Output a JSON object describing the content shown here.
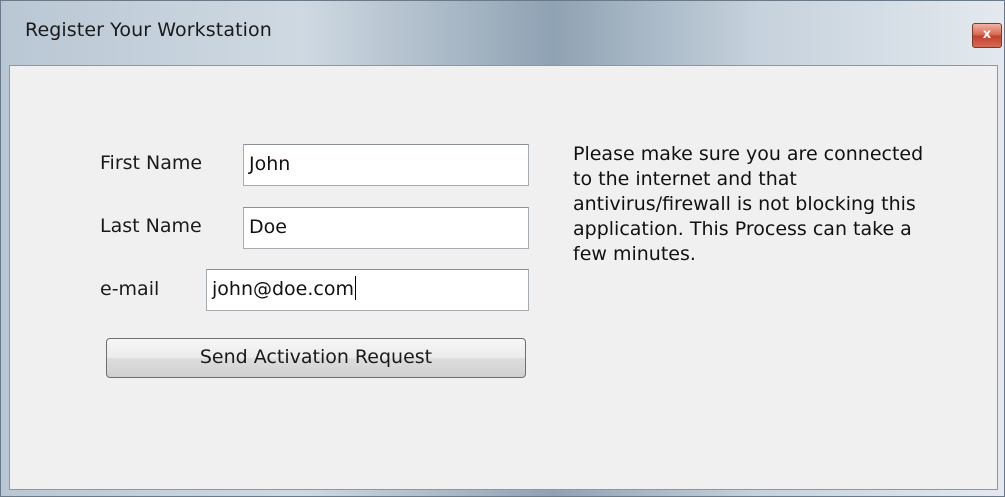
{
  "window": {
    "title": "Register Your Workstation",
    "close_label": "x"
  },
  "form": {
    "first_name": {
      "label": "First Name",
      "value": "John"
    },
    "last_name": {
      "label": "Last Name",
      "value": "Doe"
    },
    "email": {
      "label": "e-mail",
      "value": "john@doe.com"
    },
    "submit_label": "Send Activation Request"
  },
  "info": {
    "lines": [
      "Please make sure you are connected",
      "to the internet and that",
      "antivirus/firewall is not blocking this",
      "application. This Process can take a",
      "few minutes."
    ]
  },
  "colors": {
    "client_background": "#f0f0f0",
    "close_button": "#c0402c"
  },
  "icons": {
    "close": "close-icon"
  }
}
